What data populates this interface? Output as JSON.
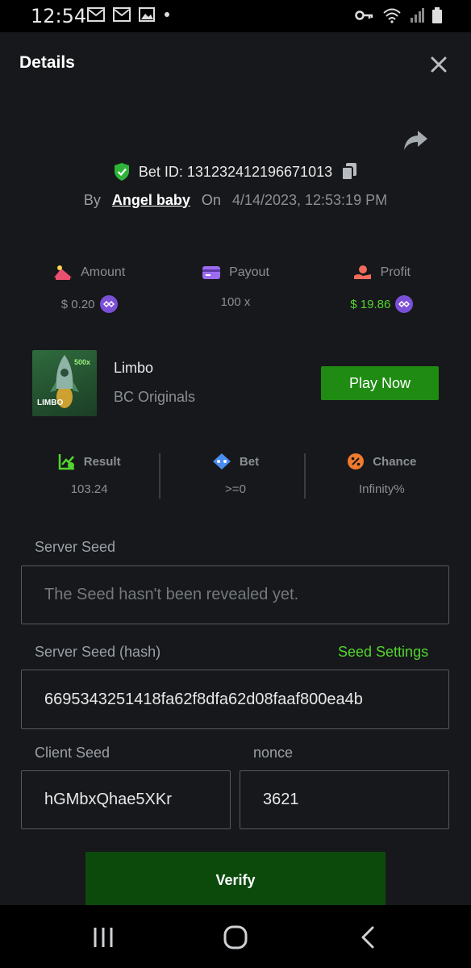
{
  "status_bar": {
    "time": "12:54",
    "left_icons": [
      "gmail-icon",
      "gmail-icon",
      "image-icon",
      "dot-icon"
    ],
    "right_icons": [
      "key-icon",
      "wifi-icon",
      "signal-icon",
      "battery-icon"
    ]
  },
  "header": {
    "title": "Details"
  },
  "bet": {
    "id_text": "Bet ID: 131232412196671013",
    "by_label": "By",
    "user": "Angel baby",
    "on_label": "On",
    "date": "4/14/2023, 12:53:19 PM"
  },
  "summary": [
    {
      "label": "Amount",
      "value": "$ 0.20",
      "coin": true
    },
    {
      "label": "Payout",
      "value": "100 x",
      "coin": false
    },
    {
      "label": "Profit",
      "value": "$ 19.86",
      "coin": true
    }
  ],
  "game": {
    "name": "Limbo",
    "provider": "BC Originals",
    "thumb_text": "LIMBO",
    "thumb_badge": "500x",
    "play_label": "Play Now"
  },
  "result_stats": [
    {
      "label": "Result",
      "value": "103.24"
    },
    {
      "label": "Bet",
      "value": ">=0"
    },
    {
      "label": "Chance",
      "value": "Infinity%"
    }
  ],
  "seeds": {
    "server_seed_label": "Server Seed",
    "server_seed_placeholder": "The Seed hasn't been revealed yet.",
    "server_hash_label": "Server Seed (hash)",
    "seed_settings_label": "Seed Settings",
    "server_hash_value": "6695343251418fa62f8dfa62d08faaf800ea4b",
    "client_seed_label": "Client Seed",
    "client_seed_value": "hGMbxQhae5XKr",
    "nonce_label": "nonce",
    "nonce_value": "3621"
  },
  "verify_label": "Verify",
  "colors": {
    "accent_green": "#52d62e",
    "play_button": "#1f8b13",
    "verify_button": "#0c4a0c",
    "sheet_bg": "#17181b",
    "coin": "#7b4fd6"
  }
}
